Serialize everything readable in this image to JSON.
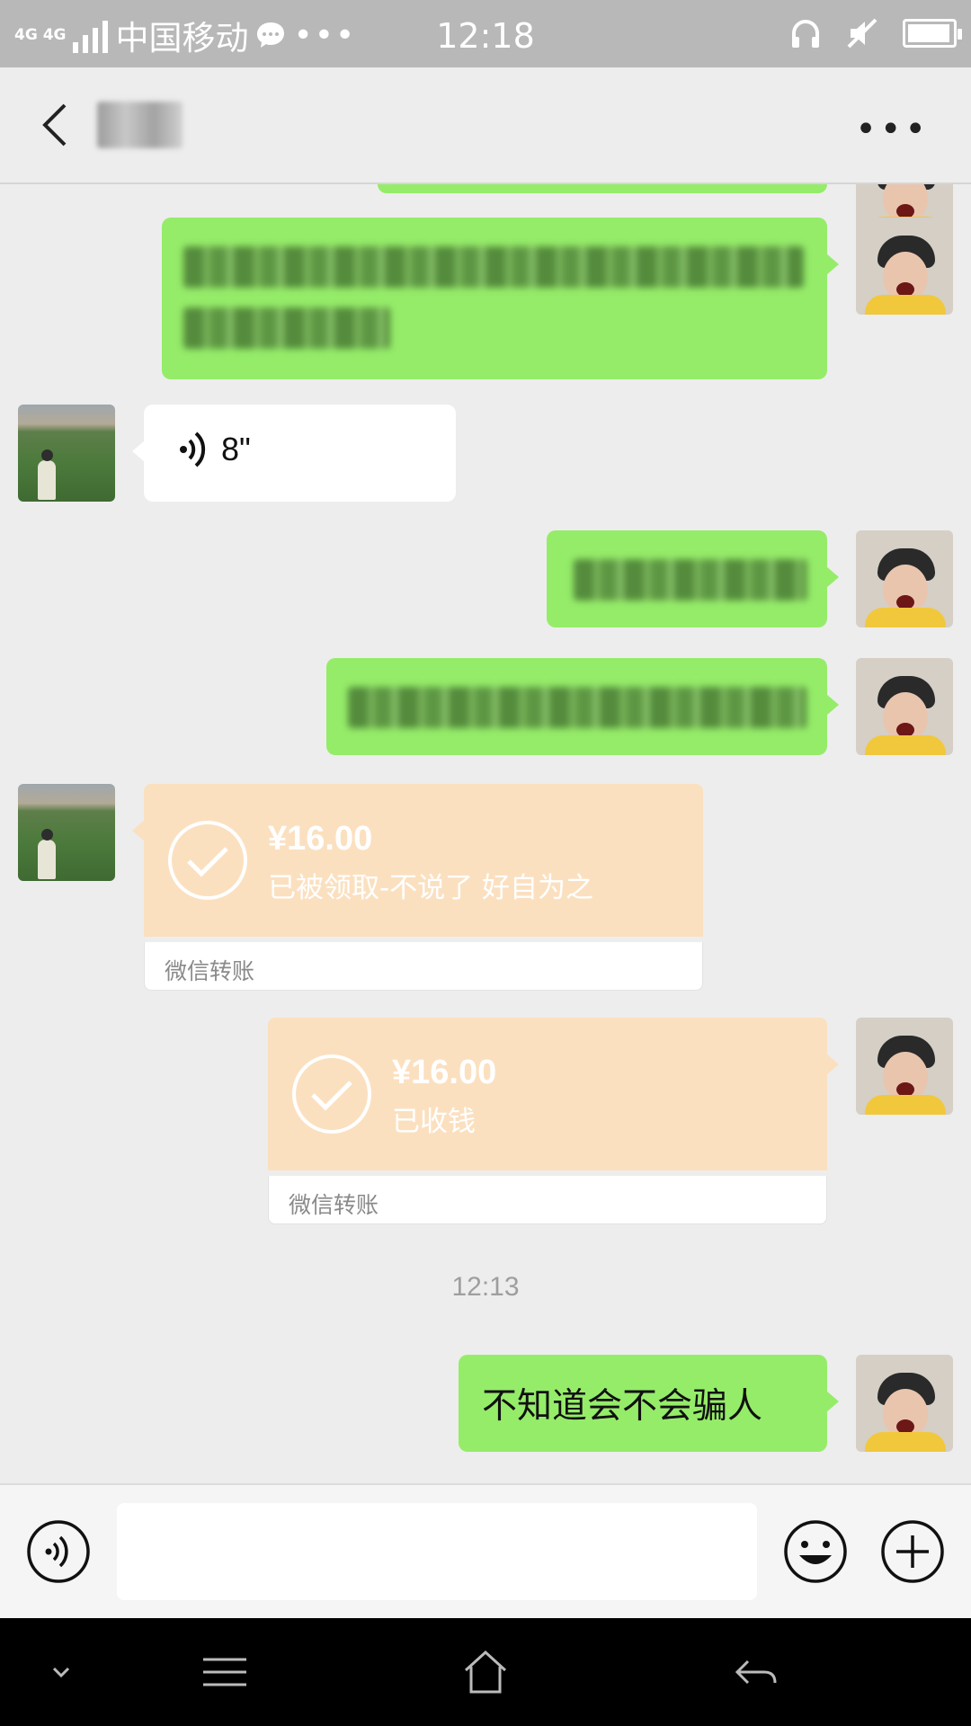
{
  "status_bar": {
    "network": "4G 4G",
    "carrier": "中国移动",
    "more": "•••",
    "time": "12:18",
    "battery_level": 0.95
  },
  "title_bar": {
    "contact_name": "",
    "menu_label": "•••"
  },
  "messages": {
    "voice": {
      "duration": "8\""
    },
    "transfer_received": {
      "amount": "¥16.00",
      "note": "已被领取-不说了 好自为之",
      "label": "微信转账"
    },
    "transfer_sent": {
      "amount": "¥16.00",
      "note": "已收钱",
      "label": "微信转账"
    },
    "timestamp": "12:13",
    "last_text": "不知道会不会骗人"
  },
  "input_bar": {
    "text_value": ""
  },
  "colors": {
    "green_bubble": "#95ec69",
    "transfer_peach": "#fbe0c0",
    "background": "#ededed"
  },
  "icons": [
    "voice-icon",
    "emoji-icon",
    "plus-icon",
    "back-icon",
    "headphone-icon",
    "mute-icon",
    "battery-icon",
    "home-icon",
    "menu-lines-icon",
    "return-icon"
  ]
}
